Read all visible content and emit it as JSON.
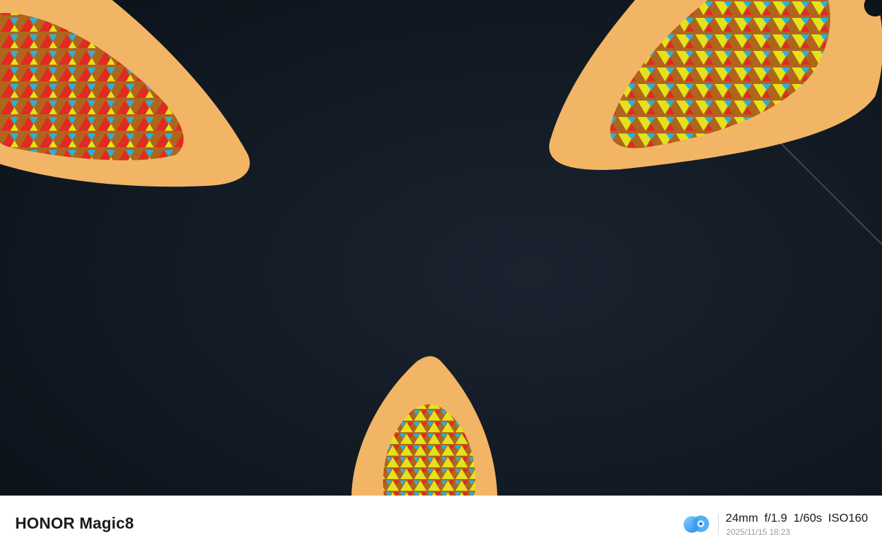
{
  "footer": {
    "brand": "HONOR Magic8",
    "focal_length": "24mm",
    "aperture": "f/1.9",
    "shutter": "1/60s",
    "iso": "ISO160",
    "timestamp": "2025/11/15 18:23",
    "logo_icon": "honor-camera-lens-icon"
  },
  "colors": {
    "background": "#0f1620",
    "leaf_body": "#f2b565",
    "triangle_red": "#e02a22",
    "triangle_yellow": "#e6e11a",
    "triangle_blue": "#2ab0e0"
  }
}
